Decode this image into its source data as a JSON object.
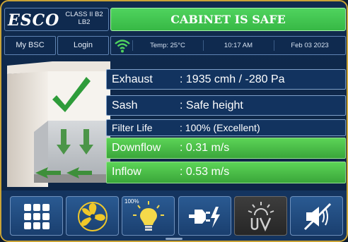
{
  "brand": {
    "logo": "ESCO",
    "class_line1": "CLASS II B2",
    "class_line2": "LB2"
  },
  "status_banner": "CABINET IS SAFE",
  "nav": {
    "my_bsc": "My BSC",
    "login": "Login"
  },
  "status_bar": {
    "wifi_icon": "wifi-icon",
    "temp": "Temp: 25°C",
    "time": "10:17 AM",
    "date": "Feb 03 2023"
  },
  "readings": [
    {
      "label": "Exhaust",
      "value": ": 1935 cmh / -280 Pa",
      "state": "normal"
    },
    {
      "label": "Sash",
      "value": ": Safe height",
      "state": "normal"
    },
    {
      "label": "Filter Life",
      "value": ": 100% (Excellent)",
      "state": "normal"
    },
    {
      "label": "Downflow",
      "value": ": 0.31 m/s",
      "state": "good"
    },
    {
      "label": "Inflow",
      "value": ": 0.53 m/s",
      "state": "good"
    }
  ],
  "toolbar": {
    "light_level": "100%",
    "icons": [
      "menu-grid-icon",
      "fan-icon",
      "light-bulb-icon",
      "power-socket-icon",
      "uv-lamp-icon",
      "alarm-mute-icon"
    ]
  },
  "colors": {
    "safe_green": "#3fbf4a",
    "panel_blue": "#12335f",
    "frame_gold": "#c9a336",
    "check_green": "#2e9c3a"
  }
}
